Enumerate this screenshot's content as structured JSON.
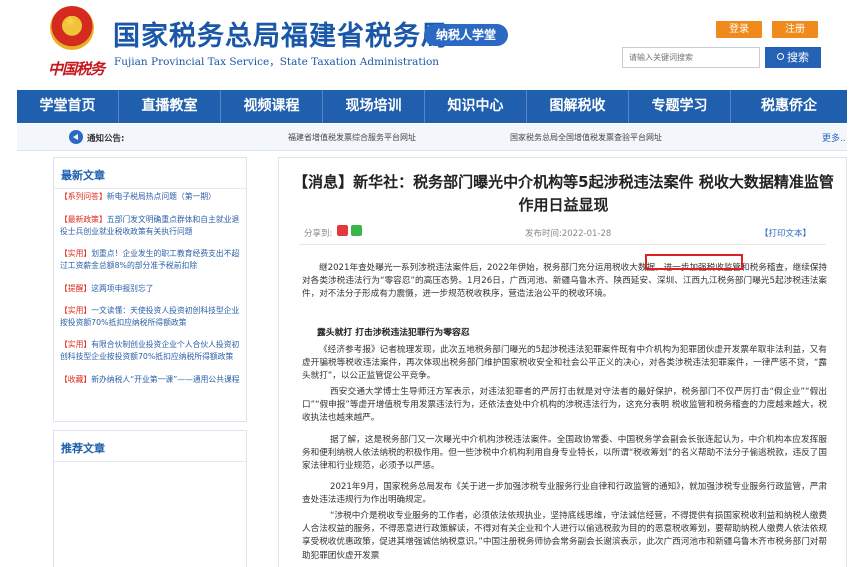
{
  "header": {
    "emblem_text": "中国税务",
    "title": "国家税务总局福建省税务局",
    "subtitle": "Fujian Provincial Tax Service，State Taxation Administration",
    "academy_badge": "纳税人学堂",
    "login_label": "登录",
    "register_label": "注册",
    "search_placeholder": "请输入关键词搜索",
    "search_button": "搜索",
    "colors": {
      "brand_blue": "#1b57a8",
      "nav_blue": "#1f5fae",
      "accent_orange": "#f08a1c",
      "alert_red": "#e0271a"
    }
  },
  "nav": {
    "items": [
      "学堂首页",
      "直播教室",
      "视频课程",
      "现场培训",
      "知识中心",
      "图解税收",
      "专题学习",
      "税惠侨企"
    ]
  },
  "notice": {
    "label": "通知公告:",
    "links": [
      "福建省增值税发票综合服务平台网址",
      "国家税务总局全国增值税发票查验平台网址"
    ],
    "more": "更多.."
  },
  "sidebar": {
    "latest_title": "最新文章",
    "latest_items": [
      {
        "tag": "【系列问答】",
        "text": "新电子税局热点问题（第一期）"
      },
      {
        "tag": "【最新政策】",
        "text": "五部门发文明确重点群体和自主就业退役士兵创业就业税收政策有关执行问题"
      },
      {
        "tag": "【实用】",
        "text": "划重点！企业发生的职工教育经费支出不超过工资薪金总额8%的部分准予税前扣除"
      },
      {
        "tag": "【提醒】",
        "text": "这两项申报别忘了"
      },
      {
        "tag": "【实用】",
        "text": "一文读懂：天使投资人投资初创科技型企业按投资额70%抵扣应纳税所得额政策"
      },
      {
        "tag": "【实用】",
        "text": "有限合伙制创业投资企业个人合伙人投资初创科技型企业按投资额70%抵扣应纳税所得额政策"
      },
      {
        "tag": "【收藏】",
        "text": "新办纳税人“开业第一课”——通用公共课程"
      }
    ],
    "recommend_title": "推荐文章"
  },
  "article": {
    "title": "【消息】新华社：税务部门曝光中介机构等5起涉税违法案件 税收大数据精准监管作用日益显现",
    "share_label": "分享到:",
    "date": "发布时间:2022-01-28",
    "print": "【打印文本】",
    "p1": "继2021年查处曝光一系列涉税违法案件后，2022年伊始，税务部门充分运用税收大数据，进一步加强税收监管和税务稽查，继续保持对各类涉税违法行为“零容忍”的高压态势。1月26日，广西河池、新疆乌鲁木齐、陕西延安、深圳、江西九江税务部门曝光5起涉税违法案件，对不法分子形成有力震慑，进一步规范税收秩序，营造法治公平的税收环境。",
    "subhead": "露头就打 打击涉税违法犯罪行为零容忍",
    "p2": "《经济参考报》记者梳理发现，此次五地税务部门曝光的5起涉税违法犯罪案件既有中介机构为犯罪团伙虚开发票牟取非法利益，又有虚开骗税等税收违法案件，再次体现出税务部门维护国家税收安全和社会公平正义的决心，对各类涉税违法犯罪案件，一律严惩不贷，“露头就打”，以公正监管促公平竞争。",
    "p3": "西安交通大学博士生导师汪方军表示，对违法犯罪者的严厉打击就是对守法者的最好保护，税务部门不仅严厉打击“假企业”“假出口”“假申报”等虚开增值税专用发票违法行为，还依法查处中介机构的涉税违法行为，这充分表明 税收监管和税务稽查的力度越来越大，税收执法也越来越严。",
    "p4": "据了解，这是税务部门又一次曝光中介机构涉税违法案件。全国政协常委、中国税务学会副会长张连起认为，中介机构本应发挥服务和便利纳税人依法纳税的积极作用。但一些涉税中介机构利用自身专业特长，以所谓“税收筹划”的名义帮助不法分子偷逃税款，违反了国家法律和行业规范，必须予以严惩。",
    "p5": "2021年9月，国家税务总局发布《关于进一步加强涉税专业服务行业自律和行政监管的通知》，就加强涉税专业服务行政监管，严肃查处违法违规行为作出明确规定。",
    "p6": "“涉税中介是税收专业服务的工作者，必须依法依规执业，坚持底线思维，守法诚信经营，不得提供有损国家税收利益和纳税人缴费人合法权益的服务，不得恶意进行政策解读，不得对有关企业和个人进行以偷逃税款为目的的恶意税收筹划，要帮助纳税人缴费人依法依规享受税收优惠政策，促进其增强诚信纳税意识。”中国注册税务师协会常务副会长谢滨表示，此次广西河池市和新疆乌鲁木齐市税务部门对帮助犯罪团伙虚开发票"
  }
}
